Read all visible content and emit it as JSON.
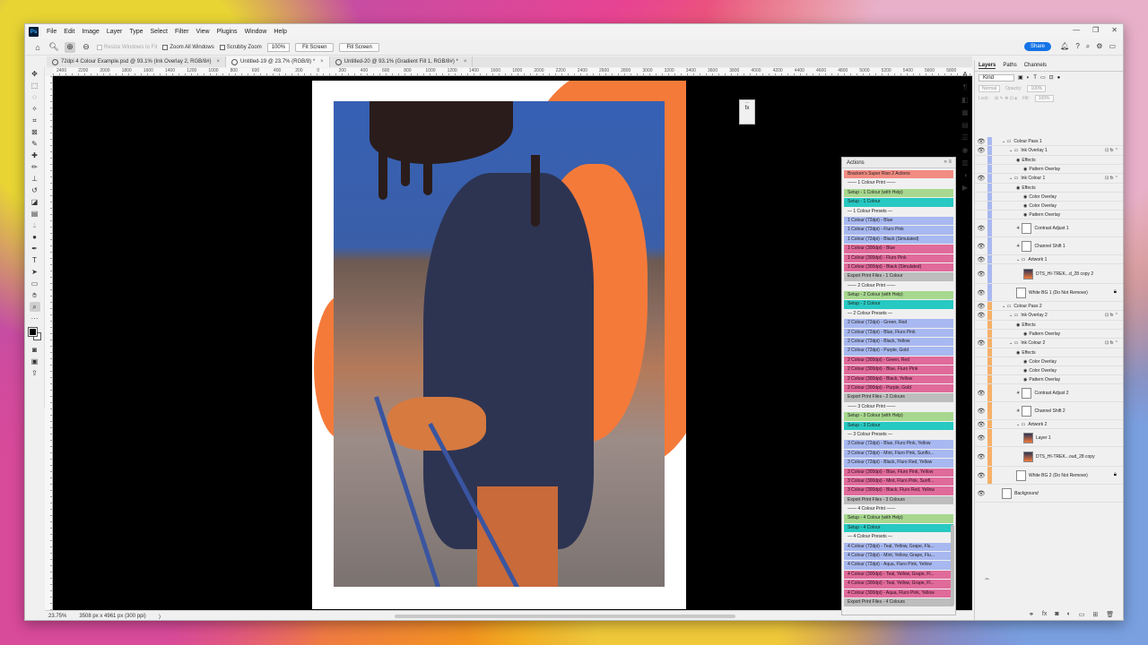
{
  "app": {
    "logo_text": "Ps",
    "menu": [
      "File",
      "Edit",
      "Image",
      "Layer",
      "Type",
      "Select",
      "Filter",
      "View",
      "Plugins",
      "Window",
      "Help"
    ],
    "window_controls": [
      "—",
      "❐",
      "✕"
    ]
  },
  "options_bar": {
    "resize_windows_label": "Resize Windows to Fit",
    "zoom_all_label": "Zoom All Windows",
    "scrubby_label": "Scrubby Zoom",
    "zoom_value": "100%",
    "fit_screen_label": "Fit Screen",
    "fill_screen_label": "Fill Screen",
    "share_label": "Share"
  },
  "tabs": [
    {
      "title": "72dpi 4 Colour Example.psd @ 93.1% (Ink Overlay 2, RGB/8#)",
      "active": false
    },
    {
      "title": "Untitled-19 @ 23.7% (RGB/8) *",
      "active": true
    },
    {
      "title": "Untitled-20 @ 93.1% (Gradient Fill 1, RGB/8#) *",
      "active": false
    }
  ],
  "ruler_ticks": [
    "2400",
    "2200",
    "2000",
    "1800",
    "1600",
    "1400",
    "1200",
    "1000",
    "800",
    "600",
    "400",
    "200",
    "0",
    "200",
    "400",
    "600",
    "800",
    "1000",
    "1200",
    "1400",
    "1600",
    "1800",
    "2000",
    "2200",
    "2400",
    "2600",
    "2800",
    "3000",
    "3200",
    "3400",
    "3600",
    "3800",
    "4000",
    "4200",
    "4400",
    "4600",
    "4800",
    "5000",
    "5200",
    "5400",
    "5600",
    "5800"
  ],
  "status": {
    "zoom": "23.75%",
    "doc_info": "3508 px x 4961 px (300 ppi)",
    "arrow": "〉"
  },
  "float_chip": {
    "label": "fx"
  },
  "actions_panel": {
    "title": "Actions",
    "items": [
      {
        "label": "Bracken's Super Riso 2 Actions",
        "color": "red"
      },
      {
        "label": "—— 1 Colour Print ——",
        "color": "none"
      },
      {
        "label": "Setup - 1 Colour (with Help)",
        "color": "green"
      },
      {
        "label": "Setup - 1 Colour",
        "color": "cyan"
      },
      {
        "label": "— 1 Colour Presets —",
        "color": "none"
      },
      {
        "label": "1 Colour (72dpi) - Blue",
        "color": "blue"
      },
      {
        "label": "1 Colour (72dpi) - Fluro Pink",
        "color": "blue"
      },
      {
        "label": "1 Colour (72dpi) - Black (Simulated)",
        "color": "blue"
      },
      {
        "label": "1 Colour (300dpi) - Blue",
        "color": "pink"
      },
      {
        "label": "1 Colour (300dpi) - Fluro Pink",
        "color": "pink"
      },
      {
        "label": "1 Colour (300dpi) - Black (Simulated)",
        "color": "pink"
      },
      {
        "label": "Export Print Files - 1 Colour",
        "color": "gray"
      },
      {
        "label": "—— 2 Colour Print ——",
        "color": "none"
      },
      {
        "label": "Setup - 2 Colour (with Help)",
        "color": "green"
      },
      {
        "label": "Setup - 2 Colour",
        "color": "cyan"
      },
      {
        "label": "— 2 Colour Presets —",
        "color": "none"
      },
      {
        "label": "2 Colour (72dpi) - Green, Red",
        "color": "blue"
      },
      {
        "label": "2 Colour (72dpi) - Blue, Fluro Pink",
        "color": "blue"
      },
      {
        "label": "2 Colour (72dpi) - Black, Yellow",
        "color": "blue"
      },
      {
        "label": "2 Colour (72dpi) - Purple, Gold",
        "color": "blue"
      },
      {
        "label": "2 Colour (300dpi) - Green, Red",
        "color": "pink"
      },
      {
        "label": "2 Colour (300dpi) - Blue, Fluro Pink",
        "color": "pink"
      },
      {
        "label": "2 Colour (300dpi) - Black, Yellow",
        "color": "pink"
      },
      {
        "label": "2 Colour (300dpi) - Purple, Gold",
        "color": "pink"
      },
      {
        "label": "Export Print Files - 2 Colours",
        "color": "gray"
      },
      {
        "label": "—— 3 Colour Print ——",
        "color": "none"
      },
      {
        "label": "Setup - 3 Colour (with Help)",
        "color": "green"
      },
      {
        "label": "Setup - 3 Colour",
        "color": "cyan"
      },
      {
        "label": "— 3 Colour Presets —",
        "color": "none"
      },
      {
        "label": "3 Colour (72dpi) - Blue, Fluro Pink, Yellow",
        "color": "blue"
      },
      {
        "label": "3 Colour (72dpi) - Mint, Fluro Pink, Sunflo...",
        "color": "blue"
      },
      {
        "label": "3 Colour (72dpi) - Black, Fluro Red, Yellow",
        "color": "blue"
      },
      {
        "label": "3 Colour (300dpi) - Blue, Fluro Pink, Yellow",
        "color": "pink"
      },
      {
        "label": "3 Colour (300dpi) - Mint, Fluro Pink, Sunfl...",
        "color": "pink"
      },
      {
        "label": "3 Colour (300dpi) - Black, Fluro Red, Yellow",
        "color": "pink"
      },
      {
        "label": "Export Print Files - 3 Colours",
        "color": "gray"
      },
      {
        "label": "—— 4 Colour Print ——",
        "color": "none"
      },
      {
        "label": "Setup - 4 Colour (with Help)",
        "color": "green"
      },
      {
        "label": "Setup - 4 Colour",
        "color": "cyan"
      },
      {
        "label": "— 4 Colour Presets —",
        "color": "none"
      },
      {
        "label": "4 Colour (72dpi) - Teal, Yellow, Grape, Flu...",
        "color": "blue"
      },
      {
        "label": "4 Colour (72dpi) - Mint, Yellow, Grape, Flu...",
        "color": "blue"
      },
      {
        "label": "4 Colour (72dpi) - Aqua, Fluro Pink, Yellow",
        "color": "blue"
      },
      {
        "label": "4 Colour (300dpi) - Teal, Yellow, Grape, Fl...",
        "color": "pink"
      },
      {
        "label": "4 Colour (300dpi) - Teal, Yellow, Grape, Fl...",
        "color": "pink"
      },
      {
        "label": "4 Colour (300dpi) - Aqua, Fluro Pink, Yellow",
        "color": "pink"
      },
      {
        "label": "Export Print Files - 4 Colours",
        "color": "gray"
      }
    ]
  },
  "layers_panel": {
    "tabs": [
      "Layers",
      "Paths",
      "Channels"
    ],
    "filter_label": "Kind",
    "blend_mode": "Normal",
    "opacity_label": "Opacity:",
    "opacity_value": "100%",
    "lock_label": "Lock:",
    "fill_label": "Fill:",
    "fill_value": "100%",
    "layers": [
      {
        "name": "Colour Pass 1",
        "indent": 1,
        "band": "blue",
        "type": "group",
        "h": 10
      },
      {
        "name": "Ink Overlay 1",
        "indent": 2,
        "band": "blue",
        "type": "group",
        "h": 11,
        "fx": true
      },
      {
        "name": "Effects",
        "indent": 3,
        "band": "blue",
        "type": "effect",
        "h": 10
      },
      {
        "name": "Pattern Overlay",
        "indent": 4,
        "band": "blue",
        "type": "effect",
        "h": 10
      },
      {
        "name": "Ink Colour 1",
        "indent": 2,
        "band": "blue",
        "type": "group",
        "h": 11,
        "fx": true
      },
      {
        "name": "Effects",
        "indent": 3,
        "band": "blue",
        "type": "effect",
        "h": 10
      },
      {
        "name": "Color Overlay",
        "indent": 4,
        "band": "blue",
        "type": "effect",
        "h": 10
      },
      {
        "name": "Color Overlay",
        "indent": 4,
        "band": "blue",
        "type": "effect",
        "h": 10
      },
      {
        "name": "Pattern Overlay",
        "indent": 4,
        "band": "blue",
        "type": "effect",
        "h": 10
      },
      {
        "name": "Contrast Adjust 1",
        "indent": 3,
        "band": "blue",
        "type": "adjust",
        "h": 20
      },
      {
        "name": "Channel Shift 1",
        "indent": 3,
        "band": "blue",
        "type": "adjust",
        "h": 20
      },
      {
        "name": "Artwork 1",
        "indent": 3,
        "band": "blue",
        "type": "group",
        "h": 10
      },
      {
        "name": "DTS_HI-TREK...d_28 copy 2",
        "indent": 4,
        "band": "blue",
        "type": "photo",
        "h": 22
      },
      {
        "name": "White BG 1 (Do Not Remove)",
        "indent": 3,
        "band": "blue",
        "type": "plain",
        "h": 20,
        "lock": true
      },
      {
        "name": "Colour Pass 2",
        "indent": 1,
        "band": "orange",
        "type": "group",
        "h": 10
      },
      {
        "name": "Ink Overlay 2",
        "indent": 2,
        "band": "orange",
        "type": "group",
        "h": 11,
        "fx": true
      },
      {
        "name": "Effects",
        "indent": 3,
        "band": "orange",
        "type": "effect",
        "h": 10
      },
      {
        "name": "Pattern Overlay",
        "indent": 4,
        "band": "orange",
        "type": "effect",
        "h": 10
      },
      {
        "name": "Ink Colour 2",
        "indent": 2,
        "band": "orange",
        "type": "group",
        "h": 11,
        "fx": true
      },
      {
        "name": "Effects",
        "indent": 3,
        "band": "orange",
        "type": "effect",
        "h": 10
      },
      {
        "name": "Color Overlay",
        "indent": 4,
        "band": "orange",
        "type": "effect",
        "h": 10
      },
      {
        "name": "Color Overlay",
        "indent": 4,
        "band": "orange",
        "type": "effect",
        "h": 10
      },
      {
        "name": "Pattern Overlay",
        "indent": 4,
        "band": "orange",
        "type": "effect",
        "h": 10
      },
      {
        "name": "Contrast Adjust 2",
        "indent": 3,
        "band": "orange",
        "type": "adjust",
        "h": 20
      },
      {
        "name": "Channel Shift 2",
        "indent": 3,
        "band": "orange",
        "type": "adjust",
        "h": 20
      },
      {
        "name": "Artwork 2",
        "indent": 3,
        "band": "orange",
        "type": "group",
        "h": 10
      },
      {
        "name": "Layer 1",
        "indent": 4,
        "band": "orange",
        "type": "photo",
        "h": 20
      },
      {
        "name": "DTS_HI-TREK...oud_28 copy",
        "indent": 4,
        "band": "orange",
        "type": "photo",
        "h": 22
      },
      {
        "name": "White BG 2 (Do Not Remove)",
        "indent": 3,
        "band": "orange",
        "type": "plain",
        "h": 20,
        "lock": true
      },
      {
        "name": "Background",
        "indent": 1,
        "band": "none",
        "type": "plain",
        "h": 20,
        "italic": true
      }
    ]
  },
  "colors": {
    "ps_blue": "#1473e6",
    "orange": "#f47a3a",
    "action_red": "#f28b82",
    "action_green": "#a8d88f",
    "action_cyan": "#27c9c2",
    "action_gray": "#bdbdbd",
    "action_blue": "#a8b8f0",
    "action_pink": "#e06b9a"
  }
}
